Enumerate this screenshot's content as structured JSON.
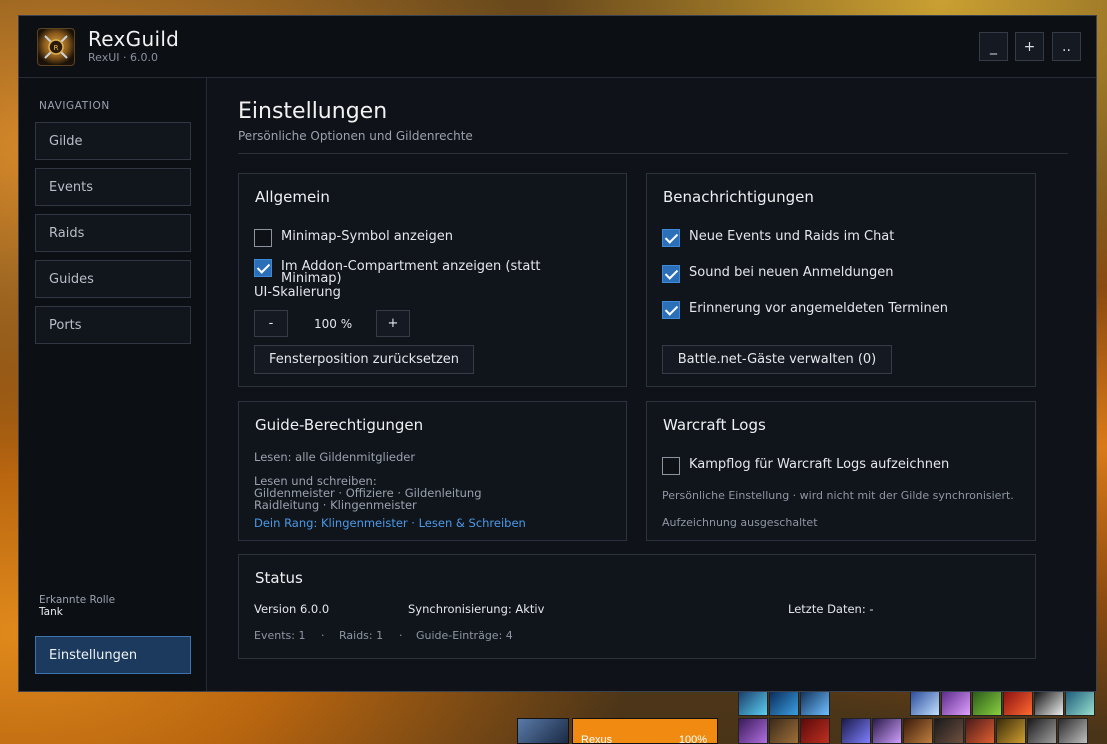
{
  "app": {
    "title": "RexGuild",
    "subtitle": "RexUI · 6.0.0"
  },
  "window_buttons": {
    "minimize": "_",
    "maximize": "+",
    "more": ".."
  },
  "sidebar": {
    "heading": "NAVIGATION",
    "items": [
      {
        "label": "Gilde"
      },
      {
        "label": "Events"
      },
      {
        "label": "Raids"
      },
      {
        "label": "Guides"
      },
      {
        "label": "Ports"
      }
    ],
    "role_label": "Erkannte Rolle",
    "role_value": "Tank",
    "settings_label": "Einstellungen"
  },
  "page": {
    "title": "Einstellungen",
    "subtitle": "Persönliche Optionen und Gildenrechte"
  },
  "general": {
    "title": "Allgemein",
    "minimap": {
      "label": "Minimap-Symbol anzeigen",
      "checked": false
    },
    "compartment": {
      "label_line1": "Im Addon-Compartment anzeigen (statt",
      "label_line2": "Minimap)",
      "checked": true
    },
    "scale_label": "UI-Skalierung",
    "scale_minus": "-",
    "scale_value": "100 %",
    "scale_plus": "+",
    "reset_button": "Fensterposition zurücksetzen"
  },
  "notifications": {
    "title": "Benachrichtigungen",
    "options": [
      {
        "label": "Neue Events und Raids im Chat",
        "checked": true
      },
      {
        "label": "Sound bei neuen Anmeldungen",
        "checked": true
      },
      {
        "label": "Erinnerung vor angemeldeten Terminen",
        "checked": true
      }
    ],
    "guests_button": "Battle.net-Gäste verwalten (0)"
  },
  "guide_permissions": {
    "title": "Guide-Berechtigungen",
    "read": "Lesen: alle Gildenmitglieder",
    "write_heading": "Lesen und schreiben:",
    "write_line1": "Gildenmeister · Offiziere · Gildenleitung",
    "write_line2": "Raidleitung · Klingenmeister",
    "rank": "Dein Rang: Klingenmeister · Lesen & Schreiben"
  },
  "warcraft_logs": {
    "title": "Warcraft Logs",
    "option": {
      "label": "Kampflog für Warcraft Logs aufzeichnen",
      "checked": false
    },
    "note": "Persönliche Einstellung · wird nicht mit der Gilde synchronisiert.",
    "state": "Aufzeichnung ausgeschaltet"
  },
  "status": {
    "title": "Status",
    "version": "Version 6.0.0",
    "sync": "Synchronisierung: Aktiv",
    "last_data": "Letzte Daten: -",
    "events": "Events: 1",
    "sep1": "·",
    "raids": "Raids: 1",
    "sep2": "·",
    "guides": "Guide-Einträge: 4"
  },
  "unit_frame": {
    "name": "Rexus",
    "health": "100%"
  }
}
